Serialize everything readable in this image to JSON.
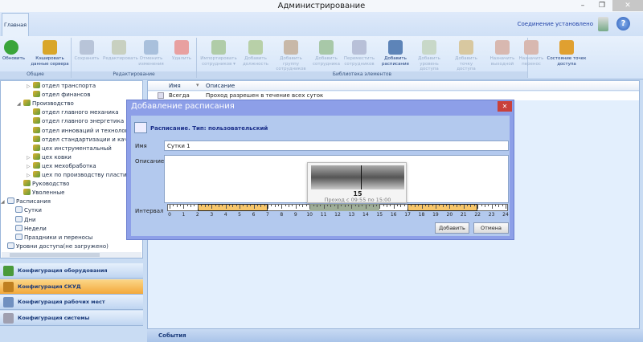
{
  "window": {
    "title": "Администрирование",
    "min": "–",
    "max": "❐",
    "close": "✕"
  },
  "ribbon": {
    "tab": "Главная",
    "connection": "Соединение установлено",
    "groups": [
      {
        "label": "Общие"
      },
      {
        "label": "Редактирование"
      },
      {
        "label": "Библиотека элементов"
      }
    ],
    "buttons": [
      {
        "label": "Обновить",
        "enabled": true,
        "color": "#3aa53a",
        "icon": "refresh-icon"
      },
      {
        "label": "Кэшировать данные сервера",
        "enabled": true,
        "color": "#d9a62a",
        "icon": "database-icon"
      },
      {
        "label": "Сохранить",
        "enabled": false,
        "color": "#b8c4d8",
        "icon": "save-icon"
      },
      {
        "label": "Редактировать",
        "enabled": false,
        "color": "#c8d0c0",
        "icon": "edit-icon"
      },
      {
        "label": "Отменить изменения",
        "enabled": false,
        "color": "#a9c0dc",
        "icon": "undo-icon"
      },
      {
        "label": "Удалить",
        "enabled": false,
        "color": "#e8a0a0",
        "icon": "delete-icon"
      },
      {
        "label": "Импортировать сотрудников ▾",
        "enabled": false,
        "color": "#b0cca8",
        "icon": "import-icon"
      },
      {
        "label": "Добавить должность",
        "enabled": false,
        "color": "#b8d0a8",
        "icon": "add-position-icon"
      },
      {
        "label": "Добавить группу сотрудников",
        "enabled": false,
        "color": "#c8b8a8",
        "icon": "add-group-icon"
      },
      {
        "label": "Добавить сотрудника",
        "enabled": false,
        "color": "#a8c8a8",
        "icon": "add-employee-icon"
      },
      {
        "label": "Переместить сотрудников",
        "enabled": false,
        "color": "#b8c0d8",
        "icon": "move-employees-icon"
      },
      {
        "label": "Добавить расписание",
        "enabled": true,
        "color": "#5d84b8",
        "icon": "add-schedule-icon"
      },
      {
        "label": "Добавить уровень доступа",
        "enabled": false,
        "color": "#c8d8c8",
        "icon": "add-access-level-icon"
      },
      {
        "label": "Добавить точку доступа",
        "enabled": false,
        "color": "#d8c8a0",
        "icon": "add-access-point-icon"
      },
      {
        "label": "Назначить выходной",
        "enabled": false,
        "color": "#d8b8b0",
        "icon": "assign-dayoff-icon"
      },
      {
        "label": "Назначить перенос",
        "enabled": false,
        "color": "#d8b8b0",
        "icon": "assign-transfer-icon"
      },
      {
        "label": "Состояние точек доступа",
        "enabled": true,
        "color": "#e0a030",
        "icon": "access-state-icon"
      }
    ]
  },
  "tree": [
    {
      "label": "отдел транспорта",
      "level": 3,
      "exp": "▷"
    },
    {
      "label": "отдел финансов",
      "level": 3,
      "exp": ""
    },
    {
      "label": "Производство",
      "level": 2,
      "exp": "◢"
    },
    {
      "label": "отдел главного механика",
      "level": 3,
      "exp": ""
    },
    {
      "label": "отдел главного энергетика",
      "level": 3,
      "exp": ""
    },
    {
      "label": "отдел инноваций и технологи",
      "level": 3,
      "exp": ""
    },
    {
      "label": "отдел стандартизации и качес",
      "level": 3,
      "exp": ""
    },
    {
      "label": "цех инструментальный",
      "level": 3,
      "exp": ""
    },
    {
      "label": "цех ковки",
      "level": 3,
      "exp": "▷"
    },
    {
      "label": "цех мехобработка",
      "level": 3,
      "exp": "▷"
    },
    {
      "label": "цех по производству пластика",
      "level": 3,
      "exp": "▷"
    },
    {
      "label": "Руководство",
      "level": 2,
      "exp": ""
    },
    {
      "label": "Уволенные",
      "level": 2,
      "exp": ""
    },
    {
      "label": "Расписания",
      "level": 0,
      "exp": "◢",
      "cal": true
    },
    {
      "label": "Сутки",
      "level": 1,
      "exp": "",
      "cal": true
    },
    {
      "label": "Дни",
      "level": 1,
      "exp": "",
      "cal": true
    },
    {
      "label": "Недели",
      "level": 1,
      "exp": "",
      "cal": true
    },
    {
      "label": "Праздники и переносы",
      "level": 1,
      "exp": "",
      "cal": true
    },
    {
      "label": "Уровни доступа(не загружено)",
      "level": 0,
      "exp": "",
      "cal": true
    }
  ],
  "nav": [
    {
      "label": "Конфигурация оборудования",
      "active": false
    },
    {
      "label": "Конфигурация СКУД",
      "active": true
    },
    {
      "label": "Конфигурация рабочих мест",
      "active": false
    },
    {
      "label": "Конфигурация системы",
      "active": false
    }
  ],
  "grid": {
    "columns": [
      "Имя",
      "Описание"
    ],
    "rows": [
      {
        "name": "Всегда",
        "desc": "Проход разрешен в течение всех суток"
      }
    ]
  },
  "events": "События",
  "dialog": {
    "title": "Добавление расписания",
    "close": "✕",
    "header": "Расписание.  Тип: пользовательский",
    "name_label": "Имя",
    "name_value": "Сутки 1",
    "desc_label": "Описание",
    "desc_value": "",
    "interval_label": "Интервал",
    "add": "Добавить",
    "cancel": "Отмена",
    "intervals": [
      {
        "from": 2,
        "to": 7,
        "state": "normal"
      },
      {
        "from": 10,
        "to": 15,
        "state": "hover"
      },
      {
        "from": 17,
        "to": 22,
        "state": "normal"
      }
    ],
    "interval_color": "#f7c66a",
    "hover_color": "#9fae98",
    "tooltip": {
      "hour": "15",
      "text": "Проход с 09:55 по 15:00"
    }
  }
}
